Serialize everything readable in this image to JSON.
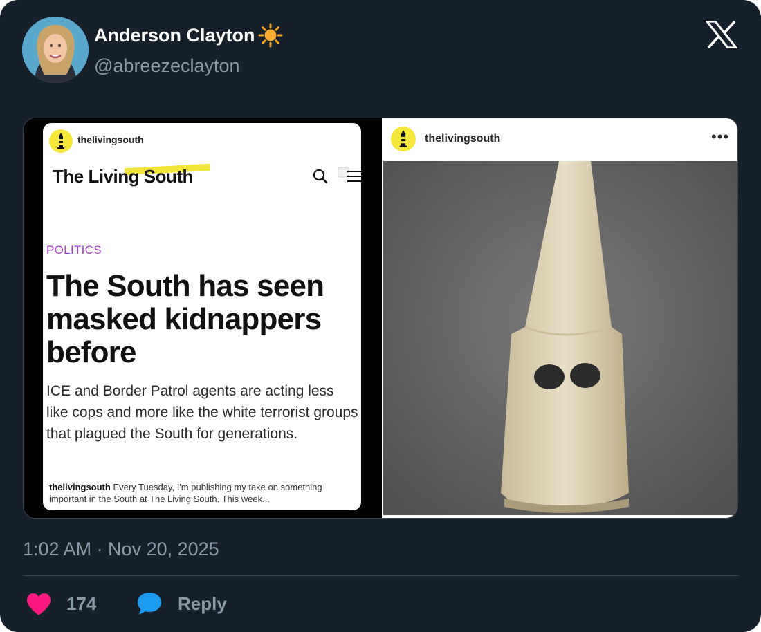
{
  "author": {
    "display_name": "Anderson Clayton",
    "handle": "@abreezeclayton",
    "name_emoji": "sun-emoji-icon"
  },
  "platform_logo": "x-logo-icon",
  "media": {
    "left_image": {
      "account": "thelivingsouth",
      "brand": "The Living South",
      "kicker": "POLITICS",
      "headline": "The South has seen masked kidnappers before",
      "dek": "ICE and Border Patrol agents are acting less like cops and more like the white terrorist groups that plagued the South for generations.",
      "caption_user": "thelivingsouth",
      "caption_text": " Every Tuesday, I'm publishing my take on something important in the South at The Living South. This week..."
    },
    "right_image": {
      "account": "thelivingsouth",
      "more": "•••",
      "photo": "white-hood-photo"
    }
  },
  "timestamp": "1:02 AM · Nov 20, 2025",
  "actions": {
    "like_count": "174",
    "reply_label": "Reply"
  },
  "colors": {
    "background": "#15202b",
    "like": "#f91880",
    "reply": "#1d9bf0",
    "muted": "#8b98a5",
    "kicker": "#a93ed1",
    "brand_highlight": "#f3e53a"
  }
}
